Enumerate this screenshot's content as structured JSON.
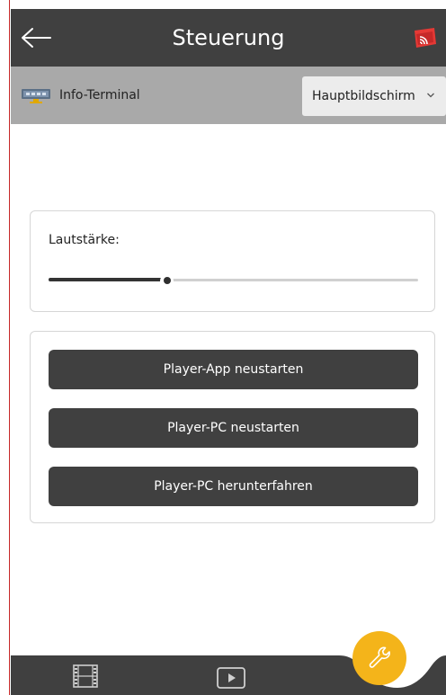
{
  "header": {
    "title": "Steuerung",
    "back_icon": "arrow-left-icon",
    "cast_icon": "cast-screen-icon"
  },
  "subbar": {
    "device_icon": "terminal-device-icon",
    "device_name": "Info-Terminal",
    "screen_select": {
      "selected": "Hauptbildschirm"
    }
  },
  "volume": {
    "label": "Lautstärke:",
    "value_percent": 32
  },
  "actions": [
    {
      "label": "Player-App neustarten"
    },
    {
      "label": "Player-PC neustarten"
    },
    {
      "label": "Player-PC herunterfahren"
    }
  ],
  "bottom_nav": {
    "items": [
      {
        "icon": "film-strip-icon"
      },
      {
        "icon": "play-screen-icon"
      }
    ],
    "fab_icon": "wrench-icon"
  },
  "colors": {
    "header": "#404040",
    "subbar": "#a9a9a9",
    "accent": "#f4b41a",
    "cast_red": "#e53935"
  }
}
